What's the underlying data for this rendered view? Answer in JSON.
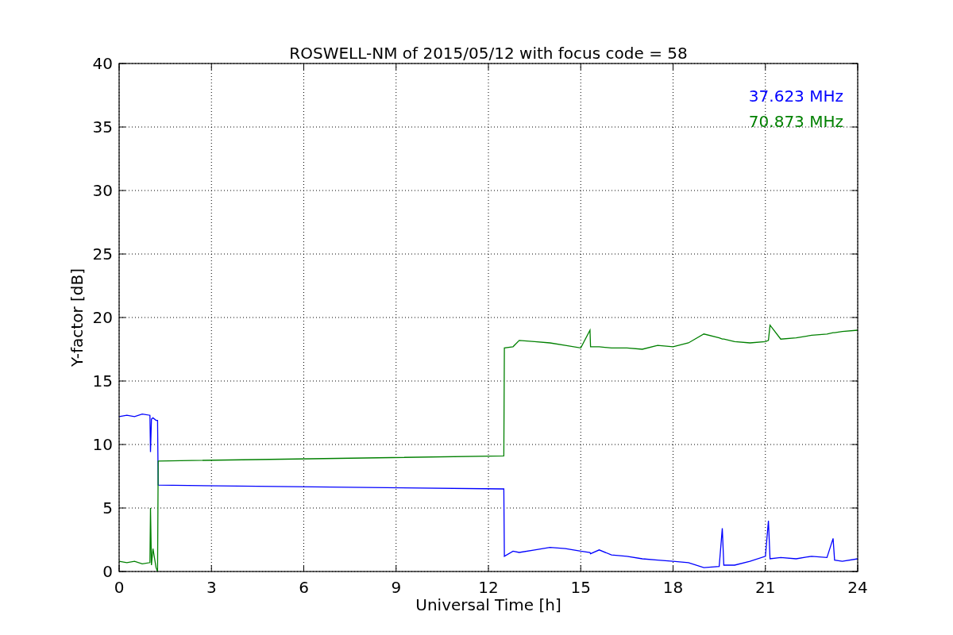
{
  "figure": {
    "chart_data": {
      "type": "line",
      "title": "ROSWELL-NM of 2015/05/12 with focus code = 58",
      "xlabel": "Universal Time [h]",
      "ylabel": "Y-factor [dB]",
      "xlim": [
        0,
        24
      ],
      "ylim": [
        0,
        40
      ],
      "grid": true,
      "xticks": [
        0,
        3,
        6,
        9,
        12,
        15,
        18,
        21,
        24
      ],
      "yticks": [
        0,
        5,
        10,
        15,
        20,
        25,
        30,
        35,
        40
      ],
      "x": [
        0,
        0.25,
        0.5,
        0.75,
        1.0,
        1.02,
        1.05,
        1.1,
        1.2,
        1.25,
        1.27,
        12.5,
        12.52,
        12.8,
        13,
        13.5,
        14,
        14.5,
        15,
        15.3,
        15.32,
        15.6,
        16,
        16.5,
        17,
        17.5,
        18,
        18.5,
        19,
        19.5,
        19.6,
        19.65,
        20,
        20.5,
        21,
        21.1,
        21.15,
        21.5,
        22,
        22.5,
        23,
        23.2,
        23.25,
        23.5,
        24
      ],
      "series": [
        {
          "name": "37.623 MHz",
          "color": "#0000ff",
          "values": [
            12.2,
            12.3,
            12.2,
            12.4,
            12.3,
            9.4,
            12.0,
            12.1,
            11.9,
            11.9,
            6.8,
            6.5,
            1.2,
            1.6,
            1.5,
            1.7,
            1.9,
            1.8,
            1.6,
            1.5,
            1.4,
            1.7,
            1.3,
            1.2,
            1.0,
            0.9,
            0.8,
            0.7,
            0.3,
            0.4,
            3.4,
            0.5,
            0.5,
            0.8,
            1.2,
            4.0,
            1.0,
            1.1,
            1.0,
            1.2,
            1.1,
            2.6,
            0.9,
            0.8,
            1.0
          ]
        },
        {
          "name": "70.873 MHz",
          "color": "#008000",
          "values": [
            0.8,
            0.7,
            0.8,
            0.6,
            0.7,
            5.0,
            0.5,
            1.8,
            0.3,
            0.0,
            8.7,
            9.1,
            17.6,
            17.7,
            18.2,
            18.1,
            18.0,
            17.8,
            17.6,
            19.0,
            17.7,
            17.7,
            17.6,
            17.6,
            17.5,
            17.8,
            17.7,
            18.0,
            18.7,
            18.4,
            18.3,
            18.3,
            18.1,
            18.0,
            18.1,
            18.2,
            19.4,
            18.3,
            18.4,
            18.6,
            18.7,
            18.8,
            18.8,
            18.9,
            19.0
          ]
        }
      ]
    }
  }
}
